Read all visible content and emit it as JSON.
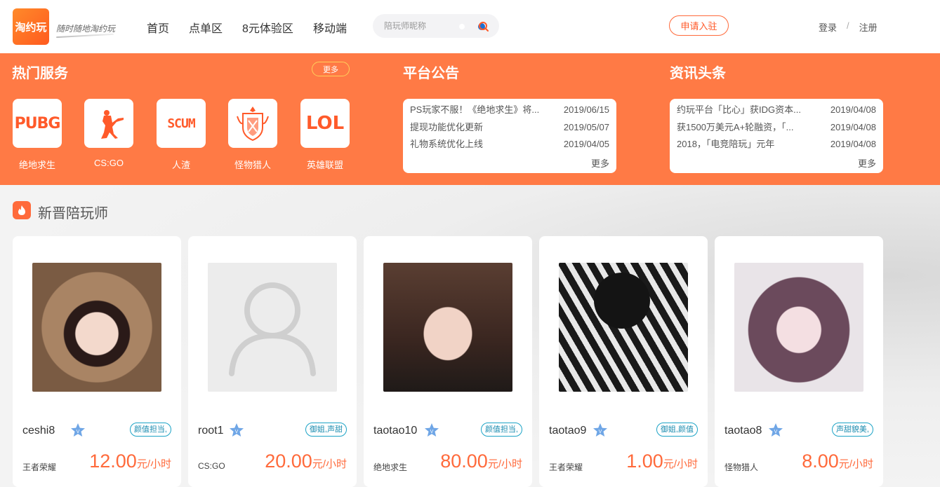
{
  "header": {
    "logo_text": "淘约玩",
    "slogan": "随时随地淘约玩",
    "nav": [
      "首页",
      "点单区",
      "8元体验区",
      "移动端"
    ],
    "search_placeholder": "陪玩师昵称",
    "apply_label": "申请入驻",
    "login_label": "登录",
    "separator": "/",
    "register_label": "注册"
  },
  "hot_services": {
    "title": "热门服务",
    "more_label": "更多",
    "games": [
      {
        "name": "绝地求生",
        "icon_text": "PUBG",
        "icon": "pubg-logo-icon"
      },
      {
        "name": "CS:GO",
        "icon_text": "",
        "icon": "csgo-soldier-icon"
      },
      {
        "name": "人渣",
        "icon_text": "SCUM",
        "icon": "scum-logo-icon"
      },
      {
        "name": "怪物猎人",
        "icon_text": "",
        "icon": "monster-hunter-crest-icon"
      },
      {
        "name": "英雄联盟",
        "icon_text": "LOL",
        "icon": "lol-logo-icon"
      }
    ]
  },
  "announcements": {
    "title": "平台公告",
    "items": [
      {
        "title": "PS玩家不服！《绝地求生》将...",
        "date": "2019/06/15"
      },
      {
        "title": "提现功能优化更新",
        "date": "2019/05/07"
      },
      {
        "title": "礼物系统优化上线",
        "date": "2019/04/05"
      }
    ],
    "more_label": "更多"
  },
  "news": {
    "title": "资讯头条",
    "items": [
      {
        "title": "约玩平台「比心」获IDG资本...",
        "date": "2019/04/08"
      },
      {
        "title": "获1500万美元A+轮融资，「...",
        "date": "2019/04/08"
      },
      {
        "title": "2018，「电竞陪玩」元年",
        "date": "2019/04/08"
      }
    ],
    "more_label": "更多"
  },
  "new_players": {
    "title": "新晋陪玩师",
    "icon": "flame-icon",
    "players": [
      {
        "name": "ceshi8",
        "tag": "颜值担当,",
        "game": "王者荣耀",
        "price": "12.00",
        "unit": "元/小时",
        "avatar": "photo-girl-fur-hood"
      },
      {
        "name": "root1",
        "tag": "御姐,声甜",
        "game": "CS:GO",
        "price": "20.00",
        "unit": "元/小时",
        "avatar": "default-avatar-icon"
      },
      {
        "name": "taotao10",
        "tag": "颜值担当,",
        "game": "绝地求生",
        "price": "80.00",
        "unit": "元/小时",
        "avatar": "photo-girl-glasses"
      },
      {
        "name": "taotao9",
        "tag": "御姐,颜值",
        "game": "王者荣耀",
        "price": "1.00",
        "unit": "元/小时",
        "avatar": "photo-boy-striped-shirt"
      },
      {
        "name": "taotao8",
        "tag": "声甜貌美,",
        "game": "怪物猎人",
        "price": "8.00",
        "unit": "元/小时",
        "avatar": "photo-girl-bangs"
      }
    ]
  },
  "colors": {
    "accent": "#ff7a45",
    "price": "#ff6a3b",
    "tag": "#1ca3c6"
  }
}
